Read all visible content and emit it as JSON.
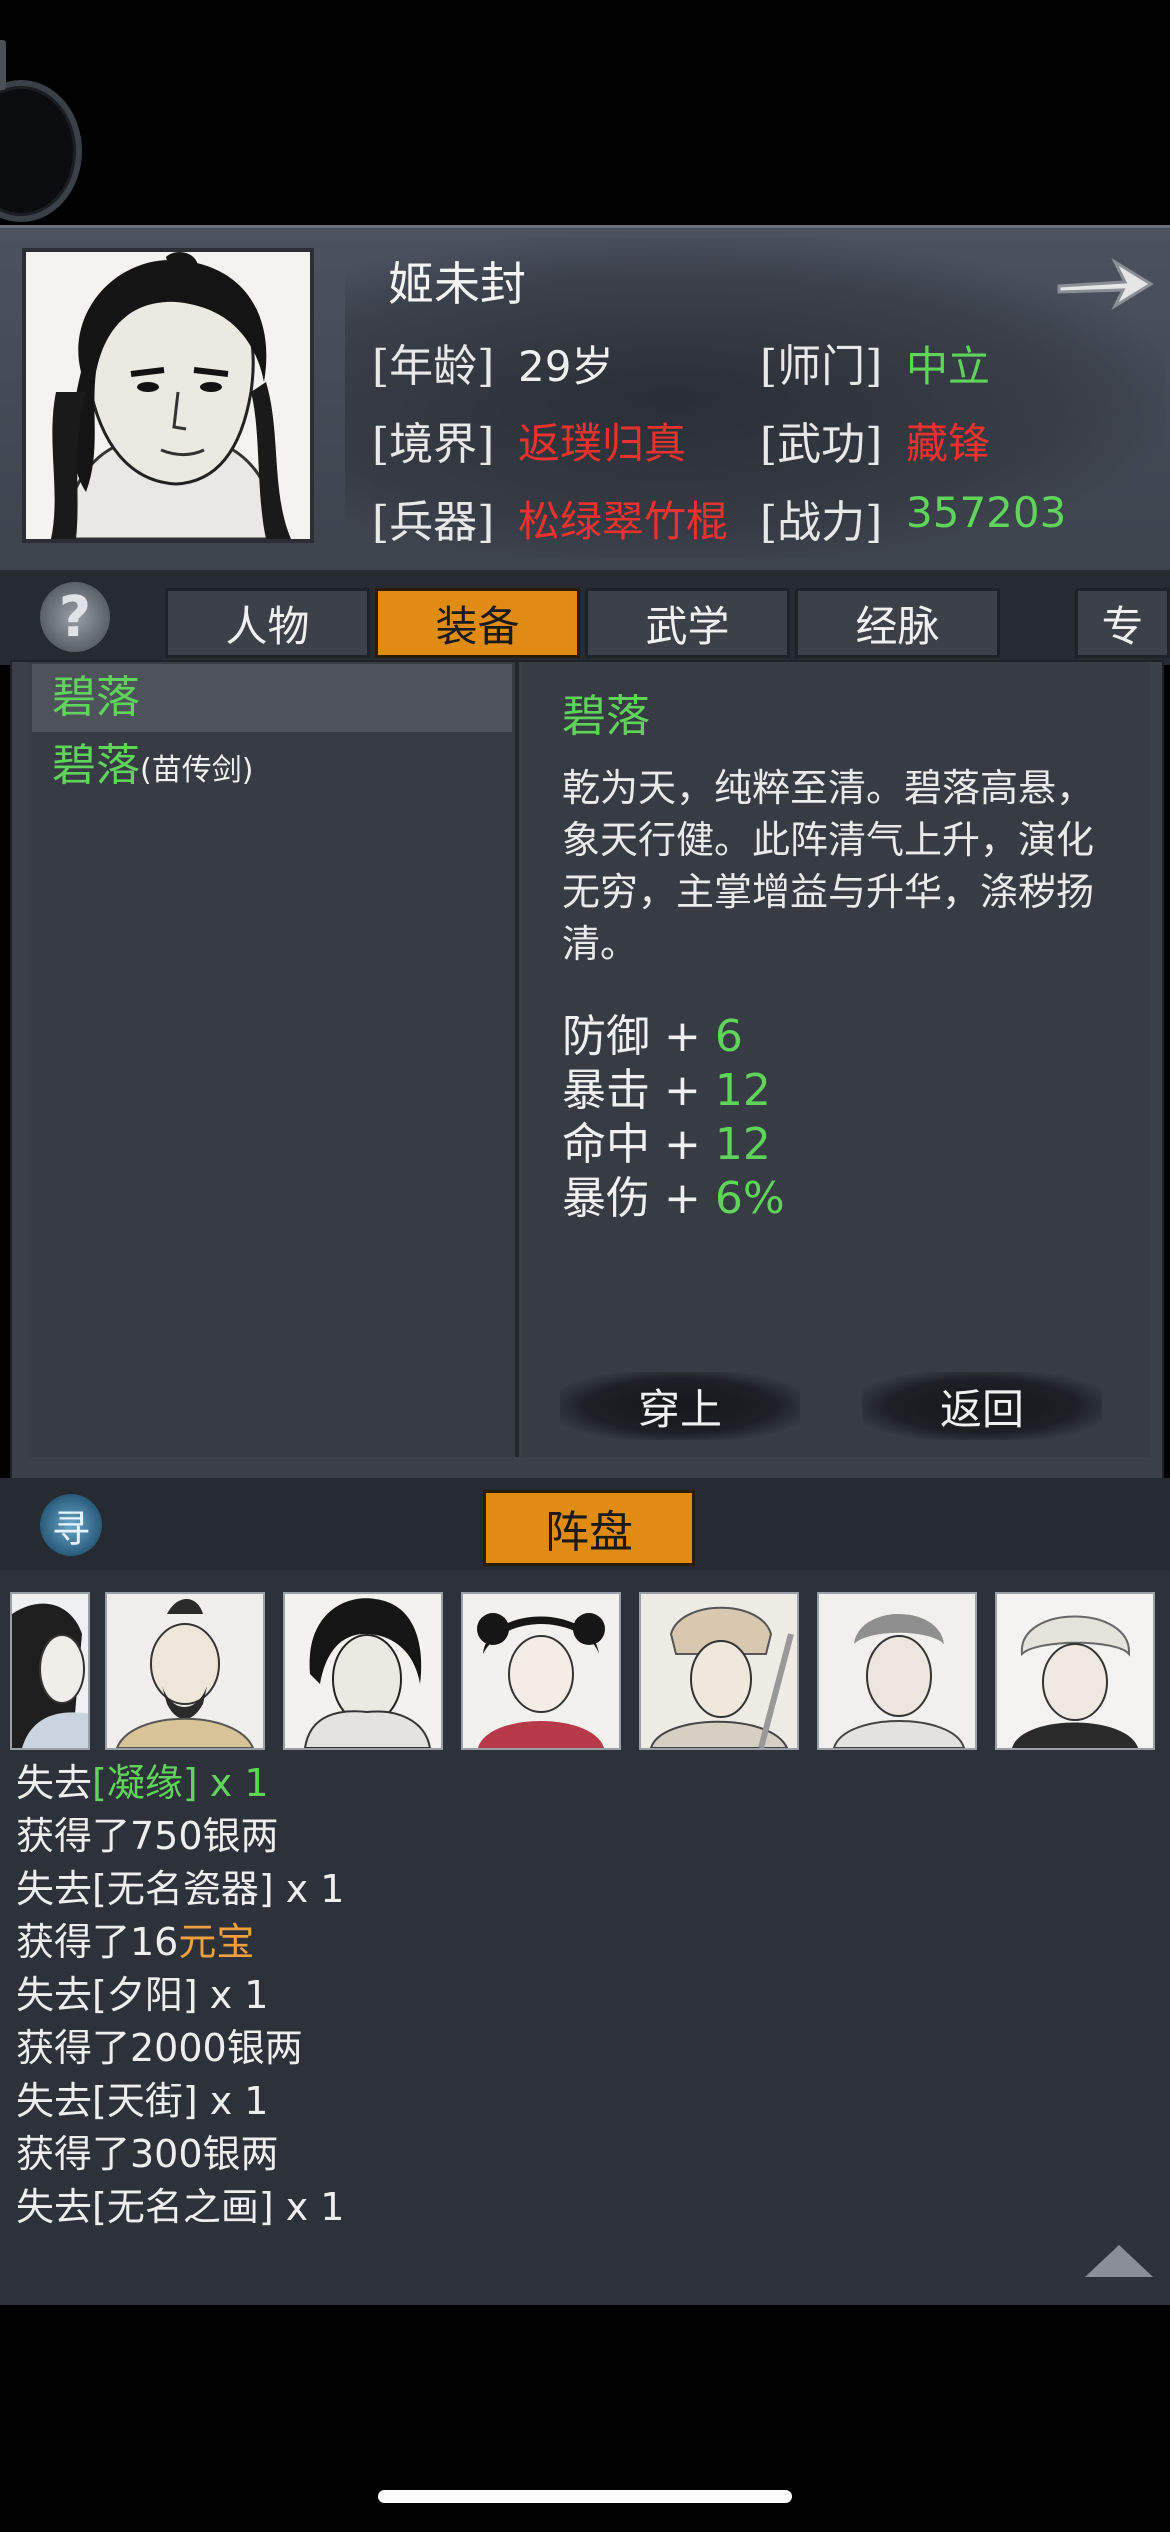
{
  "character": {
    "name": "姬未封",
    "stats": {
      "age_label": "[年龄]",
      "age_value": "29岁",
      "sect_label": "[师门]",
      "sect_value": "中立",
      "realm_label": "[境界]",
      "realm_value": "返璞归真",
      "martial_label": "[武功]",
      "martial_value": "藏锋",
      "weapon_label": "[兵器]",
      "weapon_value": "松绿翠竹棍",
      "power_label": "[战力]",
      "power_value": "357203"
    }
  },
  "help_icon": "?",
  "tabs": [
    {
      "label": "人物",
      "active": false
    },
    {
      "label": "装备",
      "active": true
    },
    {
      "label": "武学",
      "active": false
    },
    {
      "label": "经脉",
      "active": false
    },
    {
      "label": "专",
      "active": false
    }
  ],
  "list": {
    "items": [
      {
        "name": "碧落",
        "suffix": "",
        "selected": true
      },
      {
        "name": "碧落",
        "suffix": "(苗传剑)",
        "selected": false
      }
    ]
  },
  "detail": {
    "title": "碧落",
    "description": "乾为天，纯粹至清。碧落高悬，象天行健。此阵清气上升，演化无穷，主掌增益与升华，涤秽扬清。",
    "attributes": [
      {
        "name": "防御",
        "op": "+",
        "value": "6"
      },
      {
        "name": "暴击",
        "op": "+",
        "value": "12"
      },
      {
        "name": "命中",
        "op": "+",
        "value": "12"
      },
      {
        "name": "暴伤",
        "op": "+",
        "value": "6%"
      }
    ],
    "equip_label": "穿上",
    "back_label": "返回"
  },
  "seek_icon": "寻",
  "formation_tab": "阵盘",
  "log": [
    {
      "prefix": "失去",
      "highlight": "[凝缘]",
      "suffix": " x 1",
      "color": "green"
    },
    {
      "prefix": "获得了750银两",
      "highlight": "",
      "suffix": "",
      "color": ""
    },
    {
      "prefix": "失去[无名瓷器] x 1",
      "highlight": "",
      "suffix": "",
      "color": ""
    },
    {
      "prefix": "获得了16",
      "highlight": "元宝",
      "suffix": "",
      "color": "orange"
    },
    {
      "prefix": "失去[夕阳] x 1",
      "highlight": "",
      "suffix": "",
      "color": ""
    },
    {
      "prefix": "获得了2000银两",
      "highlight": "",
      "suffix": "",
      "color": ""
    },
    {
      "prefix": "失去[天街] x 1",
      "highlight": "",
      "suffix": "",
      "color": ""
    },
    {
      "prefix": "获得了300银两",
      "highlight": "",
      "suffix": "",
      "color": ""
    },
    {
      "prefix": "失去[无名之画] x 1",
      "highlight": "",
      "suffix": "",
      "color": ""
    }
  ],
  "colors": {
    "accent_orange": "#e08c14",
    "green": "#5fd35a",
    "red": "#e8322d",
    "panel": "#3a3f48"
  }
}
